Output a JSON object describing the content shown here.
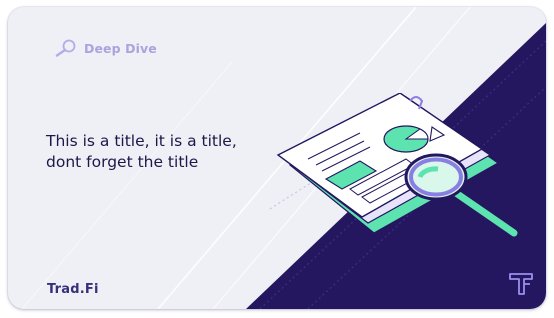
{
  "card": {
    "tag": {
      "icon": "magnifier-icon",
      "label": "Deep Dive"
    },
    "title": "This is a title, it is a title, dont forget the title",
    "brand": {
      "name": "Trad.Fi",
      "mark_icon": "tradfi-logo-icon"
    },
    "illustration": {
      "icon": "document-with-magnifier-illustration"
    }
  },
  "colors": {
    "card_background": "#efeff6",
    "dark_panel": "#24175f",
    "accent_green": "#5de3b0",
    "accent_purple": "#8a7ee3",
    "title_text": "#1d1848",
    "tag_text": "#a9a4de",
    "brand_text": "#37307a"
  }
}
